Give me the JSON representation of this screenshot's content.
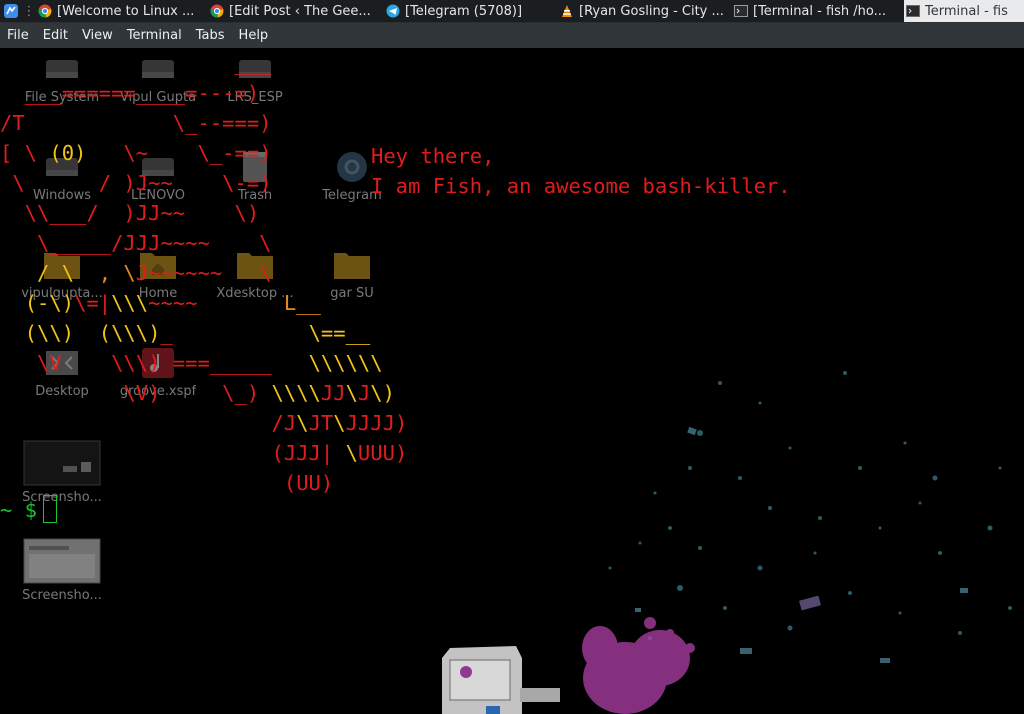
{
  "taskbar": {
    "launcher_icon": "kde-launcher-icon",
    "separator": "⋮",
    "tasks": [
      {
        "label": "[Welcome to Linux ...",
        "icon": "chrome-icon",
        "active": false
      },
      {
        "label": "[Edit Post ‹ The Gee...",
        "icon": "chrome-icon",
        "active": false
      },
      {
        "label": "[Telegram (5708)]",
        "icon": "telegram-icon",
        "active": false
      },
      {
        "label": "[Ryan Gosling - City ...",
        "icon": "vlc-icon",
        "active": false
      },
      {
        "label": "[Terminal - fish  /ho...",
        "icon": "terminal-icon",
        "active": false
      },
      {
        "label": "Terminal - fis",
        "icon": "terminal-icon",
        "active": true
      }
    ]
  },
  "menubar": {
    "items": [
      "File",
      "Edit",
      "View",
      "Terminal",
      "Tabs",
      "Help"
    ]
  },
  "terminal": {
    "greeting_line1": "Hey there,",
    "greeting_line2": "I am Fish, an awesome bash-killer.",
    "prompt": "~ $",
    "colors": {
      "red": "#e21c1c",
      "yellow": "#f2c318",
      "orange": "#e8891c",
      "green": "#19c32f"
    }
  },
  "desktop_icons": [
    {
      "label": "File System",
      "icon": "drive-icon"
    },
    {
      "label": "Vipul Gupta",
      "icon": "drive-icon"
    },
    {
      "label": "LRS_ESP",
      "icon": "drive-icon"
    },
    {
      "label": "Windows",
      "icon": "drive-icon"
    },
    {
      "label": "LENOVO",
      "icon": "drive-icon"
    },
    {
      "label": "Trash",
      "icon": "trash-icon"
    },
    {
      "label": "Telegram",
      "icon": "telegram-icon"
    },
    {
      "label": "vipulgupta...",
      "icon": "folder-icon"
    },
    {
      "label": "Home",
      "icon": "home-folder-icon"
    },
    {
      "label": "Xdesktop ...",
      "icon": "folder-icon"
    },
    {
      "label": "gar SU",
      "icon": "folder-icon"
    },
    {
      "label": "Desktop",
      "icon": "desktop-folder-icon"
    },
    {
      "label": "groove.xspf",
      "icon": "playlist-icon"
    },
    {
      "label": "Screensho...",
      "icon": "screenshot-icon"
    },
    {
      "label": "Screensho...",
      "icon": "screenshot-icon"
    }
  ]
}
